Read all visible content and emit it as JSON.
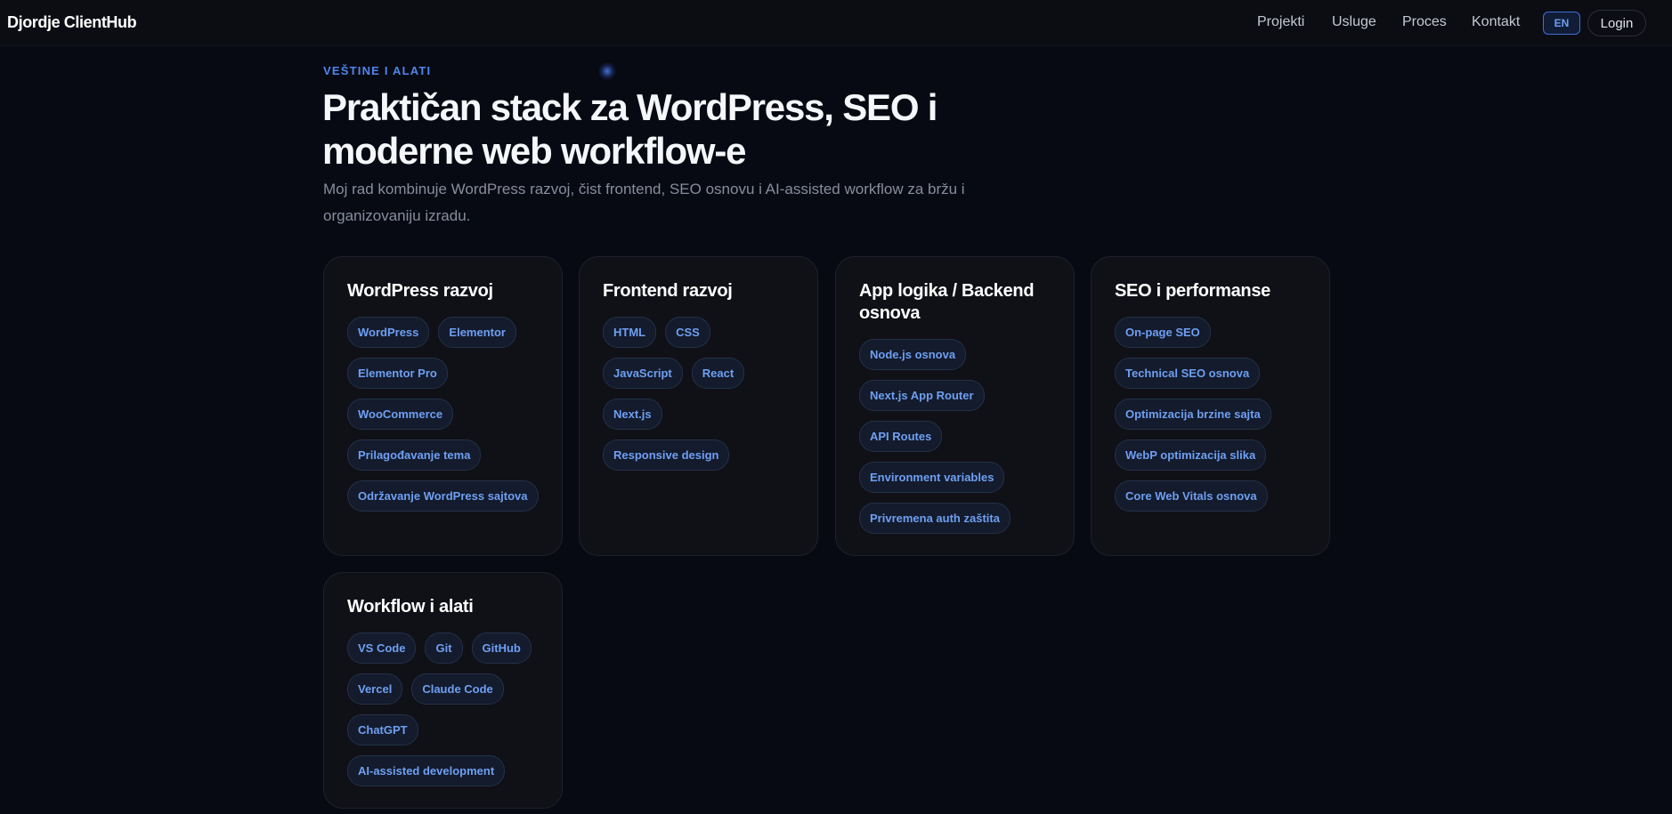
{
  "nav": {
    "brand": "Djordje ClientHub",
    "links": [
      "Projekti",
      "Usluge",
      "Proces",
      "Kontakt"
    ],
    "lang": "EN",
    "login": "Login"
  },
  "hero": {
    "eyebrow": "VEŠTINE I ALATI",
    "title": "Praktičan stack za WordPress, SEO i moderne web workflow-e",
    "subtitle": "Moj rad kombinuje WordPress razvoj, čist frontend, SEO osnovu i AI-assisted workflow za bržu i organizovaniju izradu."
  },
  "cards": [
    {
      "title": "WordPress razvoj",
      "tags": [
        "WordPress",
        "Elementor",
        "Elementor Pro",
        "WooCommerce",
        "Prilagođavanje tema",
        "Održavanje WordPress sajtova"
      ]
    },
    {
      "title": "Frontend razvoj",
      "tags": [
        "HTML",
        "CSS",
        "JavaScript",
        "React",
        "Next.js",
        "Responsive design"
      ]
    },
    {
      "title": "App logika / Backend osnova",
      "tags": [
        "Node.js osnova",
        "Next.js App Router",
        "API Routes",
        "Environment variables",
        "Privremena auth zaštita"
      ]
    },
    {
      "title": "SEO i performanse",
      "tags": [
        "On-page SEO",
        "Technical SEO osnova",
        "Optimizacija brzine sajta",
        "WebP optimizacija slika",
        "Core Web Vitals osnova"
      ]
    },
    {
      "title": "Workflow i alati",
      "tags": [
        "VS Code",
        "Git",
        "GitHub",
        "Vercel",
        "Claude Code",
        "ChatGPT",
        "AI-assisted development"
      ]
    }
  ],
  "colors": {
    "background": "#070a13",
    "accent": "#4f86ec",
    "tag_text": "#6f9ff2",
    "card_bg": "#0f1117"
  }
}
